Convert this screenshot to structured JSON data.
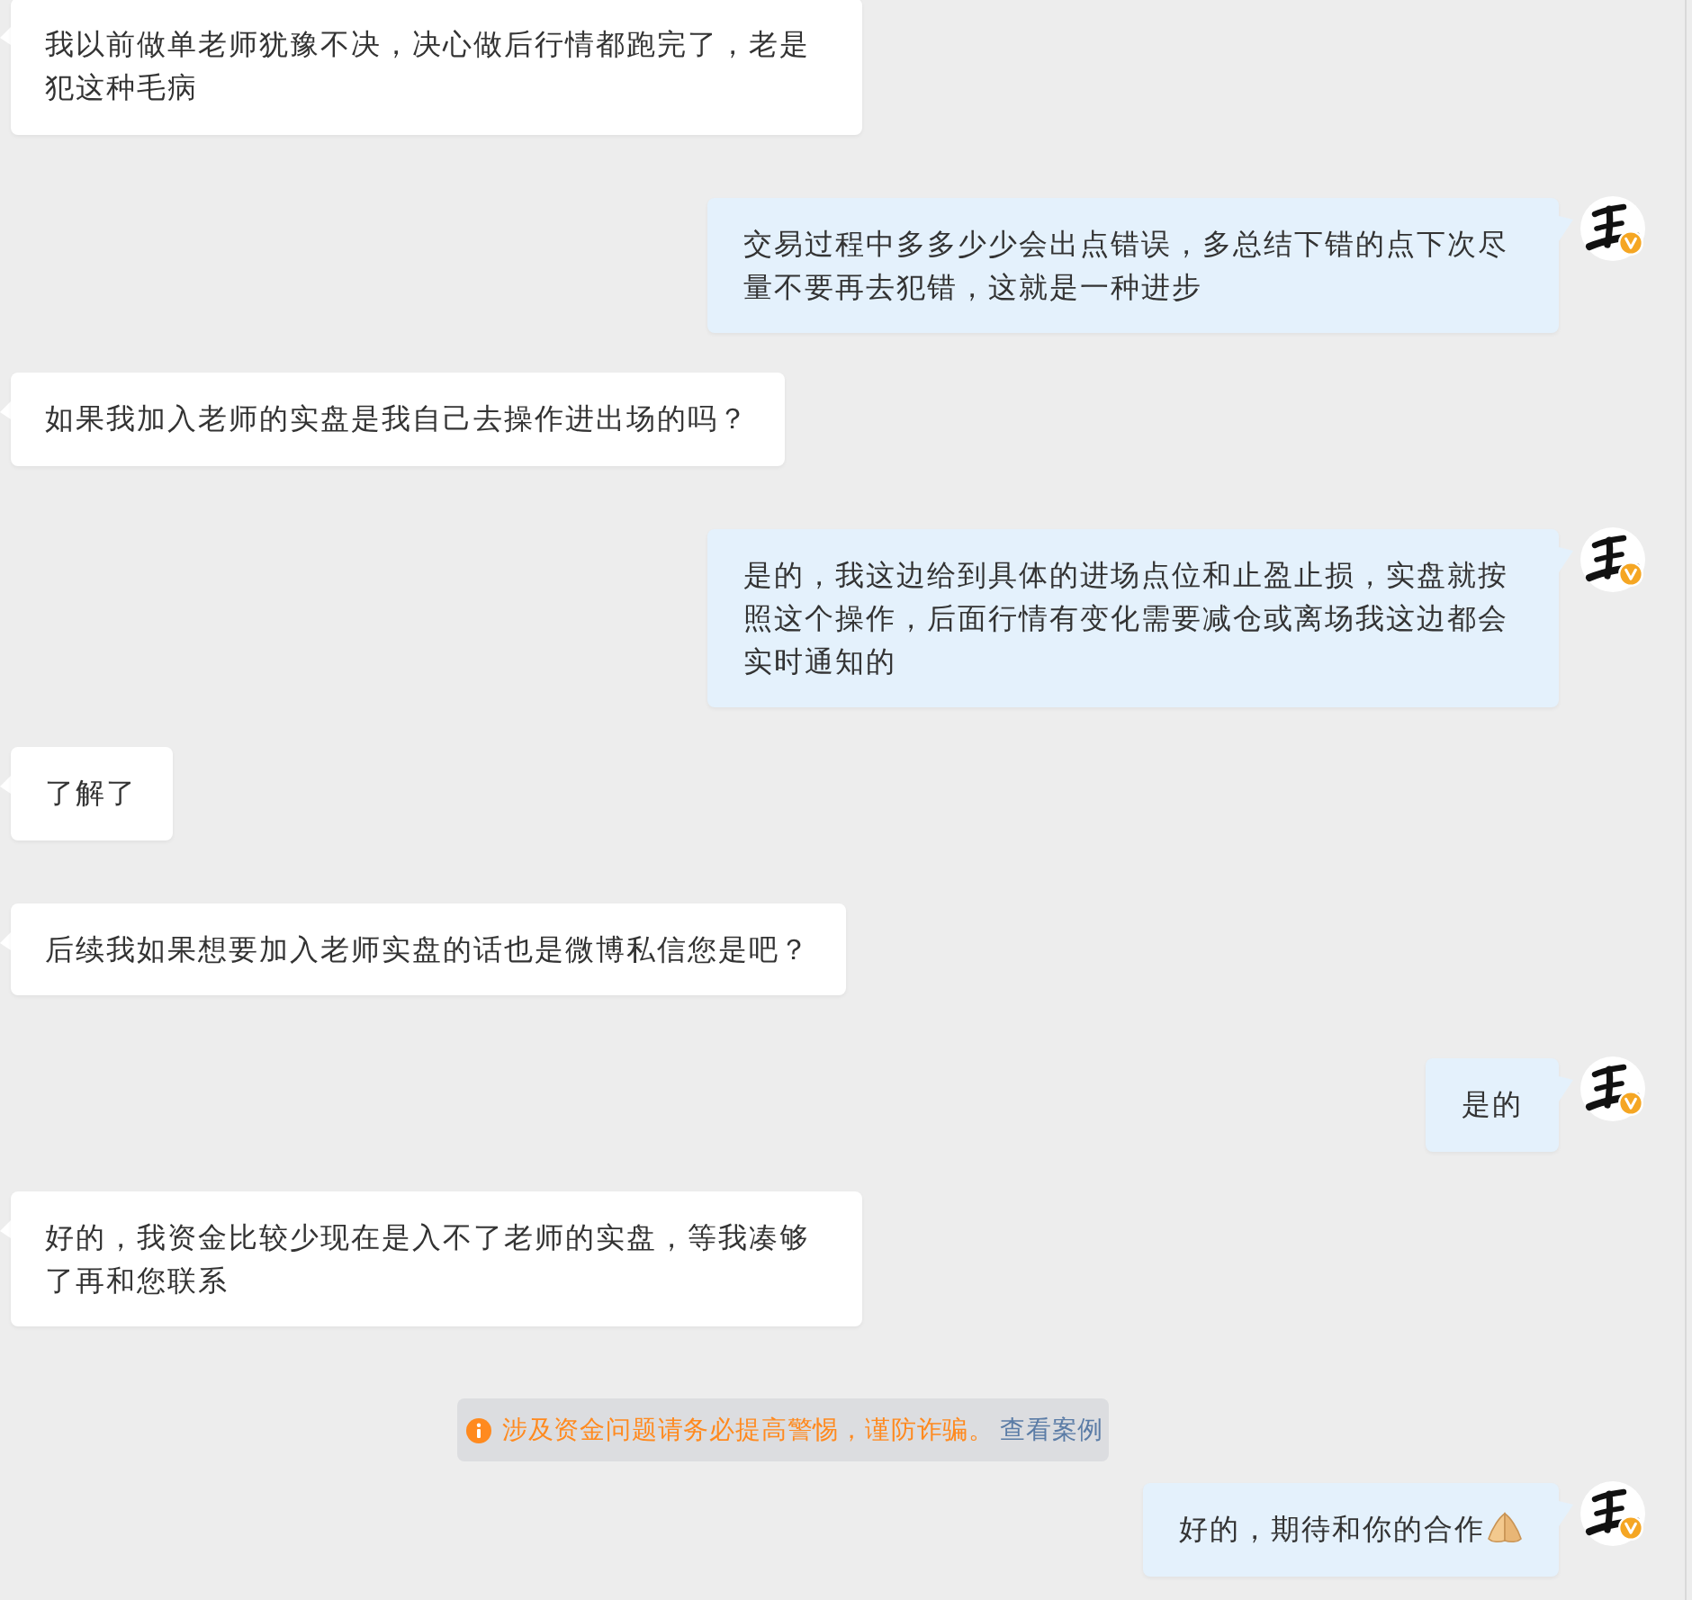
{
  "messages": [
    {
      "kind": "received",
      "text": "我以前做单老师犹豫不决，决心做后行情都跑完了，老是犯这种毛病"
    },
    {
      "kind": "sent",
      "text": "交易过程中多多少少会出点错误，多总结下错的点下次尽量不要再去犯错，这就是一种进步",
      "avatar_verified": true
    },
    {
      "kind": "received",
      "text": "如果我加入老师的实盘是我自己去操作进出场的吗？"
    },
    {
      "kind": "sent",
      "text": "是的，我这边给到具体的进场点位和止盈止损，实盘就按照这个操作，后面行情有变化需要减仓或离场我这边都会实时通知的",
      "avatar_verified": true
    },
    {
      "kind": "received",
      "text": "了解了"
    },
    {
      "kind": "received",
      "text": "后续我如果想要加入老师实盘的话也是微博私信您是吧？"
    },
    {
      "kind": "sent",
      "text": "是的",
      "avatar_verified": true
    },
    {
      "kind": "received",
      "text": "好的，我资金比较少现在是入不了老师的实盘，等我凑够了再和您联系"
    },
    {
      "kind": "notice",
      "text": "涉及资金问题请务必提高警惕，谨防诈骗。",
      "link": "查看案例"
    },
    {
      "kind": "sent",
      "text": "好的，期待和你的合作",
      "emoji": true,
      "avatar_verified": true
    }
  ]
}
